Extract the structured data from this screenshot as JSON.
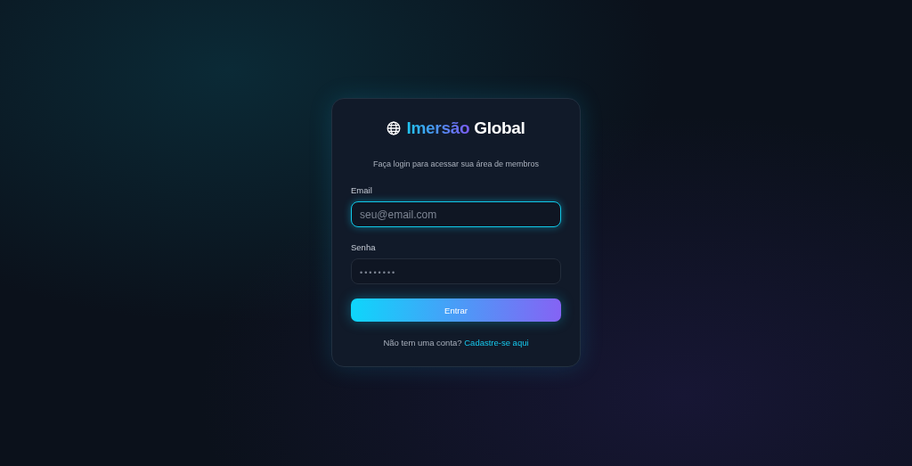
{
  "brand": {
    "accent": "Imersão",
    "rest": "Global"
  },
  "subtitle": "Faça login para acessar sua área de membros",
  "fields": [
    {
      "label": "Email",
      "placeholder": "seu@email.com",
      "focused": true
    },
    {
      "label": "Senha",
      "placeholder": "••••••••",
      "focused": false
    }
  ],
  "submit": "Entrar",
  "footer": {
    "text": "Não tem uma conta?",
    "link": "Cadastre-se aqui"
  }
}
